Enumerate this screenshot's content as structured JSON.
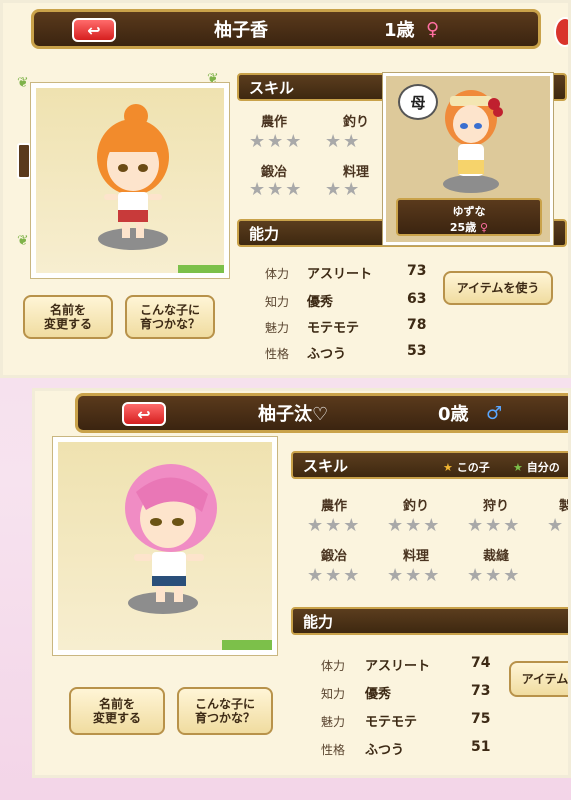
{
  "top": {
    "back_icon": "↩",
    "name": "柚子香",
    "age": "1歳",
    "gender": "♀",
    "skill_title": "スキル",
    "skills": [
      {
        "label": "農作",
        "stars": "★★★"
      },
      {
        "label": "釣り",
        "stars": "★★"
      },
      {
        "label": "鍛冶",
        "stars": "★★★"
      },
      {
        "label": "料理",
        "stars": "★★"
      }
    ],
    "ability_title": "能力",
    "stats": [
      {
        "key": "体力",
        "name": "アスリート",
        "value": "73"
      },
      {
        "key": "知力",
        "name": "優秀",
        "value": "63"
      },
      {
        "key": "魅力",
        "name": "モテモテ",
        "value": "78"
      },
      {
        "key": "性格",
        "name": "ふつう",
        "value": "53"
      }
    ],
    "rename_button": "名前を\n変更する",
    "raise_button": "こんな子に\n育つかな？",
    "item_button": "アイテムを使う",
    "mother": {
      "badge": "母",
      "name": "ゆずな",
      "age": "25歳",
      "gender": "♀"
    }
  },
  "bottom": {
    "back_icon": "↩",
    "name": "柚子汰♡",
    "age": "0歳",
    "gender": "♂",
    "skill_title": "スキル",
    "legend_this": "この子",
    "legend_self": "自分の",
    "skills": [
      {
        "label": "農作",
        "stars": "★★★"
      },
      {
        "label": "釣り",
        "stars": "★★★"
      },
      {
        "label": "狩り",
        "stars": "★★★"
      },
      {
        "label": "製",
        "stars": "★"
      },
      {
        "label": "鍛冶",
        "stars": "★★★"
      },
      {
        "label": "料理",
        "stars": "★★★"
      },
      {
        "label": "裁縫",
        "stars": "★★★"
      }
    ],
    "ability_title": "能力",
    "stats": [
      {
        "key": "体力",
        "name": "アスリート",
        "value": "74"
      },
      {
        "key": "知力",
        "name": "優秀",
        "value": "73"
      },
      {
        "key": "魅力",
        "name": "モテモテ",
        "value": "75"
      },
      {
        "key": "性格",
        "name": "ふつう",
        "value": "51"
      }
    ],
    "rename_button": "名前を\n変更する",
    "raise_button": "こんな子に\n育つかな？",
    "item_button": "アイテム"
  },
  "colors": {
    "header_bg": "#3b2410",
    "gold": "#c9a24a",
    "female": "#ff6fa1",
    "male": "#5aa7ff",
    "background": "#f3d9ea"
  }
}
